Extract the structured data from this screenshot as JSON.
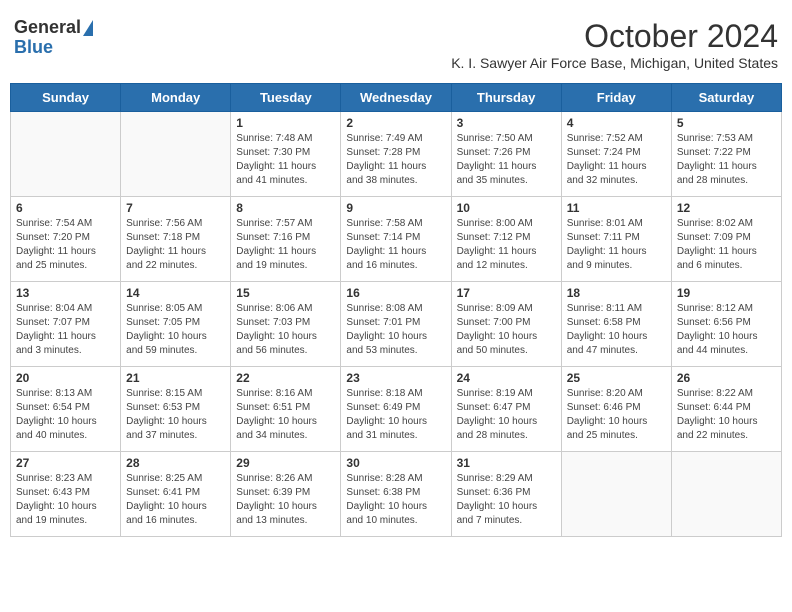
{
  "logo": {
    "general": "General",
    "blue": "Blue"
  },
  "title": "October 2024",
  "subtitle": "K. I. Sawyer Air Force Base, Michigan, United States",
  "days": [
    "Sunday",
    "Monday",
    "Tuesday",
    "Wednesday",
    "Thursday",
    "Friday",
    "Saturday"
  ],
  "weeks": [
    [
      {
        "day": "",
        "content": ""
      },
      {
        "day": "",
        "content": ""
      },
      {
        "day": "1",
        "content": "Sunrise: 7:48 AM\nSunset: 7:30 PM\nDaylight: 11 hours and 41 minutes."
      },
      {
        "day": "2",
        "content": "Sunrise: 7:49 AM\nSunset: 7:28 PM\nDaylight: 11 hours and 38 minutes."
      },
      {
        "day": "3",
        "content": "Sunrise: 7:50 AM\nSunset: 7:26 PM\nDaylight: 11 hours and 35 minutes."
      },
      {
        "day": "4",
        "content": "Sunrise: 7:52 AM\nSunset: 7:24 PM\nDaylight: 11 hours and 32 minutes."
      },
      {
        "day": "5",
        "content": "Sunrise: 7:53 AM\nSunset: 7:22 PM\nDaylight: 11 hours and 28 minutes."
      }
    ],
    [
      {
        "day": "6",
        "content": "Sunrise: 7:54 AM\nSunset: 7:20 PM\nDaylight: 11 hours and 25 minutes."
      },
      {
        "day": "7",
        "content": "Sunrise: 7:56 AM\nSunset: 7:18 PM\nDaylight: 11 hours and 22 minutes."
      },
      {
        "day": "8",
        "content": "Sunrise: 7:57 AM\nSunset: 7:16 PM\nDaylight: 11 hours and 19 minutes."
      },
      {
        "day": "9",
        "content": "Sunrise: 7:58 AM\nSunset: 7:14 PM\nDaylight: 11 hours and 16 minutes."
      },
      {
        "day": "10",
        "content": "Sunrise: 8:00 AM\nSunset: 7:12 PM\nDaylight: 11 hours and 12 minutes."
      },
      {
        "day": "11",
        "content": "Sunrise: 8:01 AM\nSunset: 7:11 PM\nDaylight: 11 hours and 9 minutes."
      },
      {
        "day": "12",
        "content": "Sunrise: 8:02 AM\nSunset: 7:09 PM\nDaylight: 11 hours and 6 minutes."
      }
    ],
    [
      {
        "day": "13",
        "content": "Sunrise: 8:04 AM\nSunset: 7:07 PM\nDaylight: 11 hours and 3 minutes."
      },
      {
        "day": "14",
        "content": "Sunrise: 8:05 AM\nSunset: 7:05 PM\nDaylight: 10 hours and 59 minutes."
      },
      {
        "day": "15",
        "content": "Sunrise: 8:06 AM\nSunset: 7:03 PM\nDaylight: 10 hours and 56 minutes."
      },
      {
        "day": "16",
        "content": "Sunrise: 8:08 AM\nSunset: 7:01 PM\nDaylight: 10 hours and 53 minutes."
      },
      {
        "day": "17",
        "content": "Sunrise: 8:09 AM\nSunset: 7:00 PM\nDaylight: 10 hours and 50 minutes."
      },
      {
        "day": "18",
        "content": "Sunrise: 8:11 AM\nSunset: 6:58 PM\nDaylight: 10 hours and 47 minutes."
      },
      {
        "day": "19",
        "content": "Sunrise: 8:12 AM\nSunset: 6:56 PM\nDaylight: 10 hours and 44 minutes."
      }
    ],
    [
      {
        "day": "20",
        "content": "Sunrise: 8:13 AM\nSunset: 6:54 PM\nDaylight: 10 hours and 40 minutes."
      },
      {
        "day": "21",
        "content": "Sunrise: 8:15 AM\nSunset: 6:53 PM\nDaylight: 10 hours and 37 minutes."
      },
      {
        "day": "22",
        "content": "Sunrise: 8:16 AM\nSunset: 6:51 PM\nDaylight: 10 hours and 34 minutes."
      },
      {
        "day": "23",
        "content": "Sunrise: 8:18 AM\nSunset: 6:49 PM\nDaylight: 10 hours and 31 minutes."
      },
      {
        "day": "24",
        "content": "Sunrise: 8:19 AM\nSunset: 6:47 PM\nDaylight: 10 hours and 28 minutes."
      },
      {
        "day": "25",
        "content": "Sunrise: 8:20 AM\nSunset: 6:46 PM\nDaylight: 10 hours and 25 minutes."
      },
      {
        "day": "26",
        "content": "Sunrise: 8:22 AM\nSunset: 6:44 PM\nDaylight: 10 hours and 22 minutes."
      }
    ],
    [
      {
        "day": "27",
        "content": "Sunrise: 8:23 AM\nSunset: 6:43 PM\nDaylight: 10 hours and 19 minutes."
      },
      {
        "day": "28",
        "content": "Sunrise: 8:25 AM\nSunset: 6:41 PM\nDaylight: 10 hours and 16 minutes."
      },
      {
        "day": "29",
        "content": "Sunrise: 8:26 AM\nSunset: 6:39 PM\nDaylight: 10 hours and 13 minutes."
      },
      {
        "day": "30",
        "content": "Sunrise: 8:28 AM\nSunset: 6:38 PM\nDaylight: 10 hours and 10 minutes."
      },
      {
        "day": "31",
        "content": "Sunrise: 8:29 AM\nSunset: 6:36 PM\nDaylight: 10 hours and 7 minutes."
      },
      {
        "day": "",
        "content": ""
      },
      {
        "day": "",
        "content": ""
      }
    ]
  ]
}
